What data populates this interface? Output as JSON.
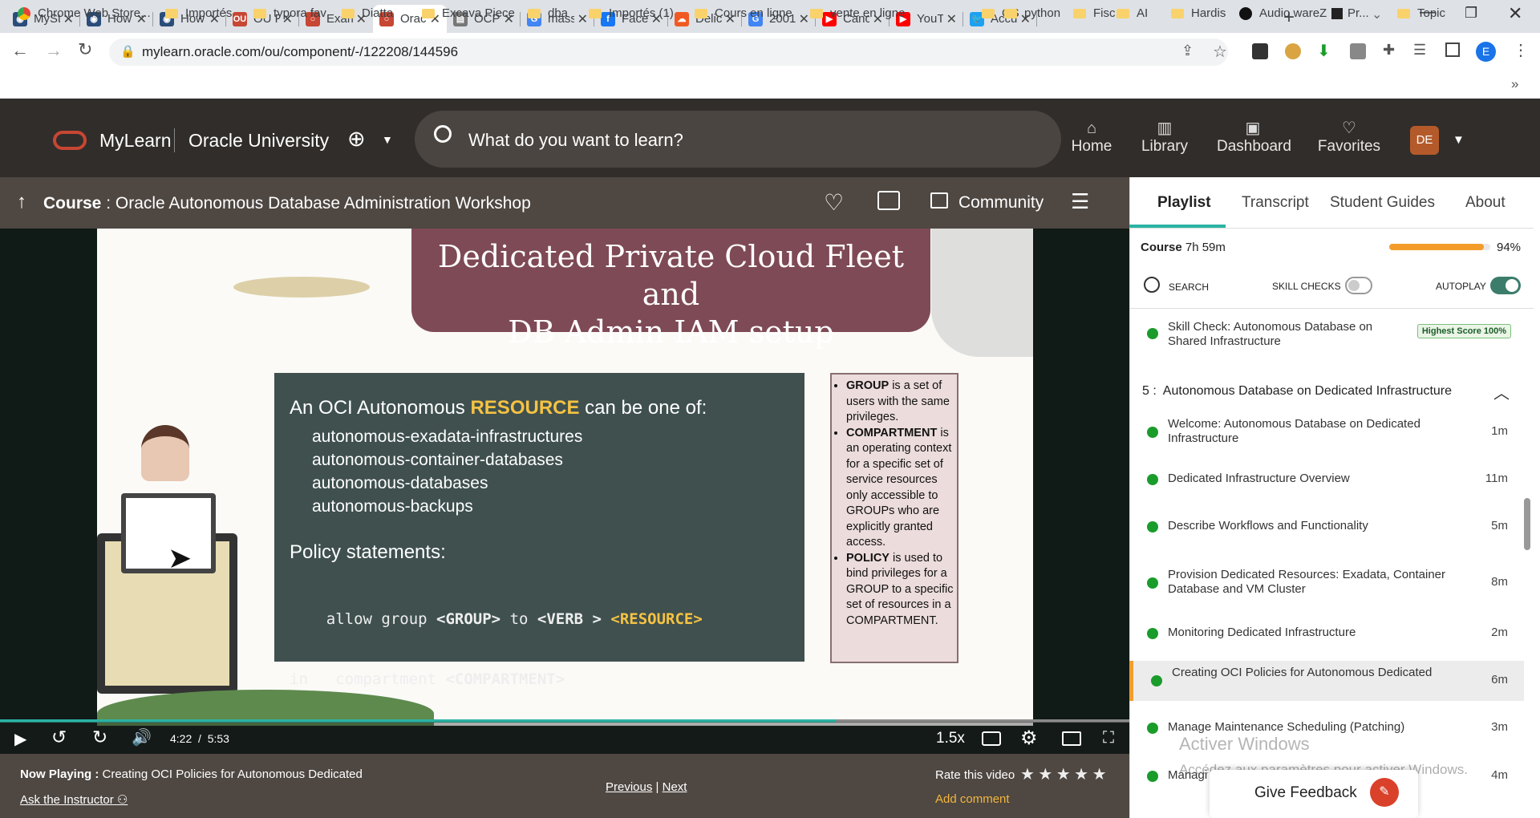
{
  "browser": {
    "tabs": [
      {
        "title": "MySt",
        "color": "#2a4d7a",
        "glyph": "◉"
      },
      {
        "title": "How",
        "color": "#2a4d7a",
        "glyph": "◉"
      },
      {
        "title": "How",
        "color": "#2a4d7a",
        "glyph": "◉"
      },
      {
        "title": "OU F",
        "color": "#c74634",
        "glyph": "OU"
      },
      {
        "title": "Exam",
        "color": "#c74634",
        "glyph": "○"
      },
      {
        "title": "Orac",
        "color": "#c74634",
        "glyph": "○"
      },
      {
        "title": "OCP",
        "color": "#777",
        "glyph": "▤"
      },
      {
        "title": "mass",
        "color": "#4285f4",
        "glyph": "G"
      },
      {
        "title": "Face",
        "color": "#1877f2",
        "glyph": "f"
      },
      {
        "title": "Delic",
        "color": "#f05a22",
        "glyph": "☁"
      },
      {
        "title": "2001",
        "color": "#4285f4",
        "glyph": "G"
      },
      {
        "title": "Canc",
        "color": "#ff0000",
        "glyph": "▶"
      },
      {
        "title": "YouT",
        "color": "#ff0000",
        "glyph": "▶"
      },
      {
        "title": "Accu",
        "color": "#1da1f2",
        "glyph": "🐦"
      }
    ],
    "url": "mylearn.oracle.com/ou/component/-/122208/144596",
    "profile_initial": "E",
    "bookmarks": [
      "Chrome Web Store...",
      "Importés",
      "typora fav",
      "Diatta",
      "Excava Piece",
      "dba",
      "Importés (1)",
      "Cours en ligne",
      "vente en ligne",
      "OS",
      "python",
      "Fisc",
      "AI",
      "Hardis",
      "Audio wareZ",
      "Pr...",
      "Topic"
    ]
  },
  "header": {
    "brand": "MyLearn",
    "product": "Oracle University",
    "search_placeholder": "What do you want to learn?",
    "nav": [
      {
        "label": "Home",
        "icon": "home-icon",
        "glyph": "⌂"
      },
      {
        "label": "Library",
        "icon": "library-icon",
        "glyph": "▥"
      },
      {
        "label": "Dashboard",
        "icon": "dashboard-icon",
        "glyph": "▣"
      },
      {
        "label": "Favorites",
        "icon": "heart-icon",
        "glyph": "♡"
      }
    ],
    "avatar": "DE"
  },
  "course": {
    "prefix": "Course",
    "title": "Oracle Autonomous Database Administration Workshop",
    "community": "Community"
  },
  "slide": {
    "title_line1": "Dedicated Private Cloud Fleet and",
    "title_line2": "DB Admin IAM setup",
    "intro_a": "An OCI Autonomous ",
    "intro_resource": "RESOURCE",
    "intro_b": " can be one of:",
    "resources": [
      "autonomous-exadata-infrastructures",
      "autonomous-container-databases",
      "autonomous-databases",
      "autonomous-backups"
    ],
    "policy_heading": "Policy statements:",
    "policy_line1_a": "allow group ",
    "policy_group": "<GROUP>",
    "policy_to": " to ",
    "policy_verb": "<VERB >",
    "policy_res": "<RESOURCE>",
    "policy_line2_a": "in   compartment ",
    "policy_comp": "<COMPARTMENT>",
    "notes": [
      {
        "b": "GROUP",
        "t": " is a set of users with the same privileges."
      },
      {
        "b": "COMPARTMENT",
        "t": " is an operating context for a specific set of service resources only accessible to GROUPs who are explicitly granted access."
      },
      {
        "b": "POLICY",
        "t": " is used to bind privileges for a GROUP to a specific set of resources in a COMPARTMENT."
      }
    ]
  },
  "player": {
    "time": "4:22  /  5:53",
    "speed": "1.5x",
    "progress": 0.74
  },
  "now_playing": {
    "label": "Now Playing :",
    "title": "Creating OCI Policies for Autonomous Dedicated",
    "ask": "Ask the Instructor",
    "previous": "Previous",
    "sep": "|",
    "next": "Next",
    "rate": "Rate this video",
    "add_comment": "Add comment"
  },
  "panel": {
    "tabs": [
      "Playlist",
      "Transcript",
      "Student Guides",
      "About"
    ],
    "course_label": "Course",
    "course_duration": "7h 59m",
    "progress_text": "94%",
    "progress": 0.94,
    "search": "SEARCH",
    "skill_checks": "SKILL CHECKS",
    "autoplay": "AUTOPLAY",
    "skill_check_title": "Skill Check: Autonomous Database on Shared Infrastructure",
    "highest_score": "Highest Score 100%",
    "section": "5 :  Autonomous Database on Dedicated Infrastructure",
    "items": [
      {
        "title": "Welcome: Autonomous Database on Dedicated Infrastructure",
        "dur": "1m"
      },
      {
        "title": "Dedicated Infrastructure Overview",
        "dur": "11m"
      },
      {
        "title": "Describe Workflows and Functionality",
        "dur": "5m"
      },
      {
        "title": "Provision Dedicated Resources: Exadata, Container Database and VM Cluster",
        "dur": "8m"
      },
      {
        "title": "Monitoring Dedicated Infrastructure",
        "dur": "2m"
      },
      {
        "title": "Creating OCI Policies for Autonomous Dedicated",
        "dur": "6m"
      },
      {
        "title": "Manage Maintenance Scheduling (Patching)",
        "dur": "3m"
      },
      {
        "title": "Managi",
        "dur": "4m"
      }
    ],
    "feedback": "Give Feedback",
    "watermark1": "Activer Windows",
    "watermark2": "Accédez aux paramètres pour activer Windows."
  }
}
